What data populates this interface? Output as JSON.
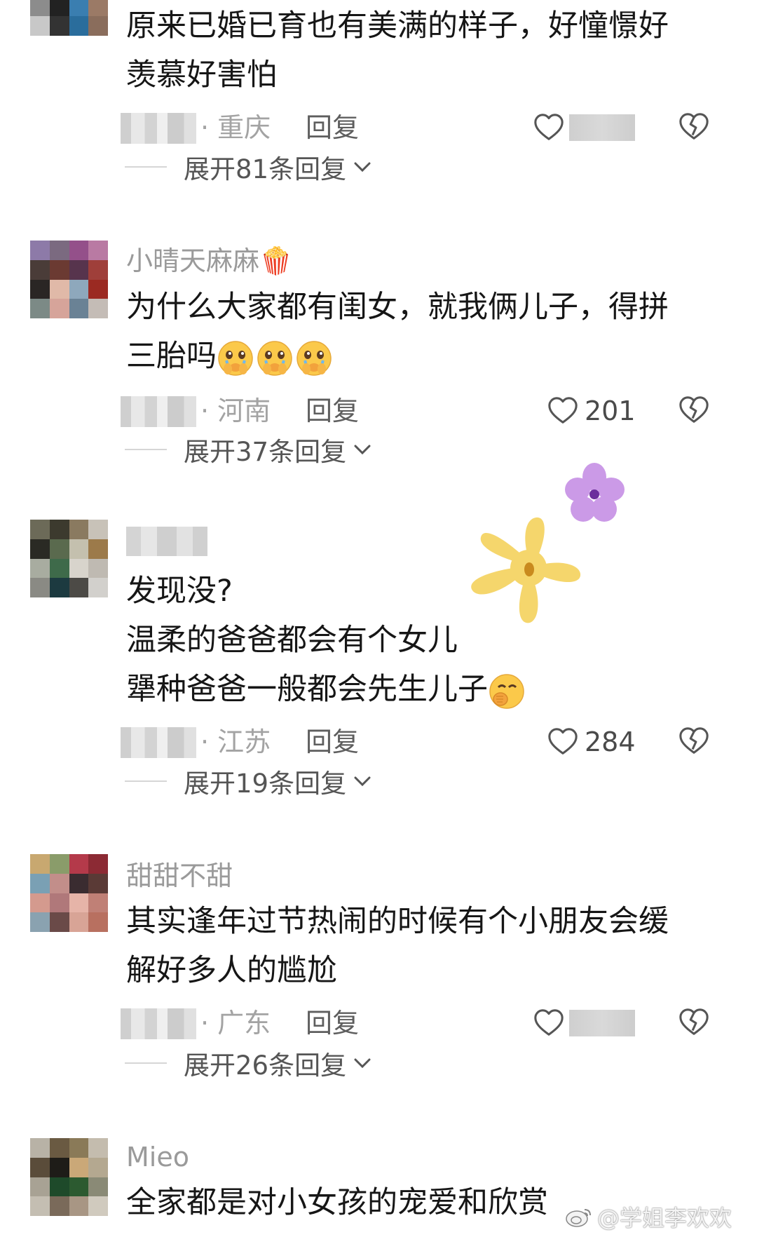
{
  "comments": [
    {
      "username": "",
      "lines": [
        "原来已婚已育也有美满的样子，好憧憬好",
        "羡慕好害怕"
      ],
      "location": "· 重庆",
      "reply": "回复",
      "likes": "",
      "expand": "展开81条回复"
    },
    {
      "username": "小晴天麻麻🍿",
      "lines": [
        "为什么大家都有闺女，就我俩儿子，得拼",
        "三胎吗"
      ],
      "location": "· 河南",
      "reply": "回复",
      "likes": "201",
      "expand": "展开37条回复"
    },
    {
      "username": "",
      "lines": [
        "发现没?",
        "温柔的爸爸都会有个女儿",
        "犟种爸爸一般都会先生儿子"
      ],
      "location": "· 江苏",
      "reply": "回复",
      "likes": "284",
      "expand": "展开19条回复"
    },
    {
      "username": "甜甜不甜",
      "lines": [
        "其实逢年过节热闹的时候有个小朋友会缓",
        "解好多人的尴尬"
      ],
      "location": "· 广东",
      "reply": "回复",
      "likes": "",
      "expand": "展开26条回复"
    },
    {
      "username": "Mieo",
      "lines": [
        "全家都是对小女孩的宠爱和欣赏"
      ]
    }
  ],
  "watermark": "@学姐李欢欢",
  "icons": {
    "like": "heart-outline-icon",
    "dislike": "broken-heart-icon",
    "expand": "chevron-down-icon",
    "emoji_cry": "crying-face-emoji",
    "emoji_hand": "face-with-hand-over-mouth-emoji"
  },
  "colors": {
    "text": "#161616",
    "username": "#9a9a9a",
    "meta": "#a3a3a3",
    "flower_yellow": "#f5d66c",
    "flower_purple": "#c995e6"
  }
}
